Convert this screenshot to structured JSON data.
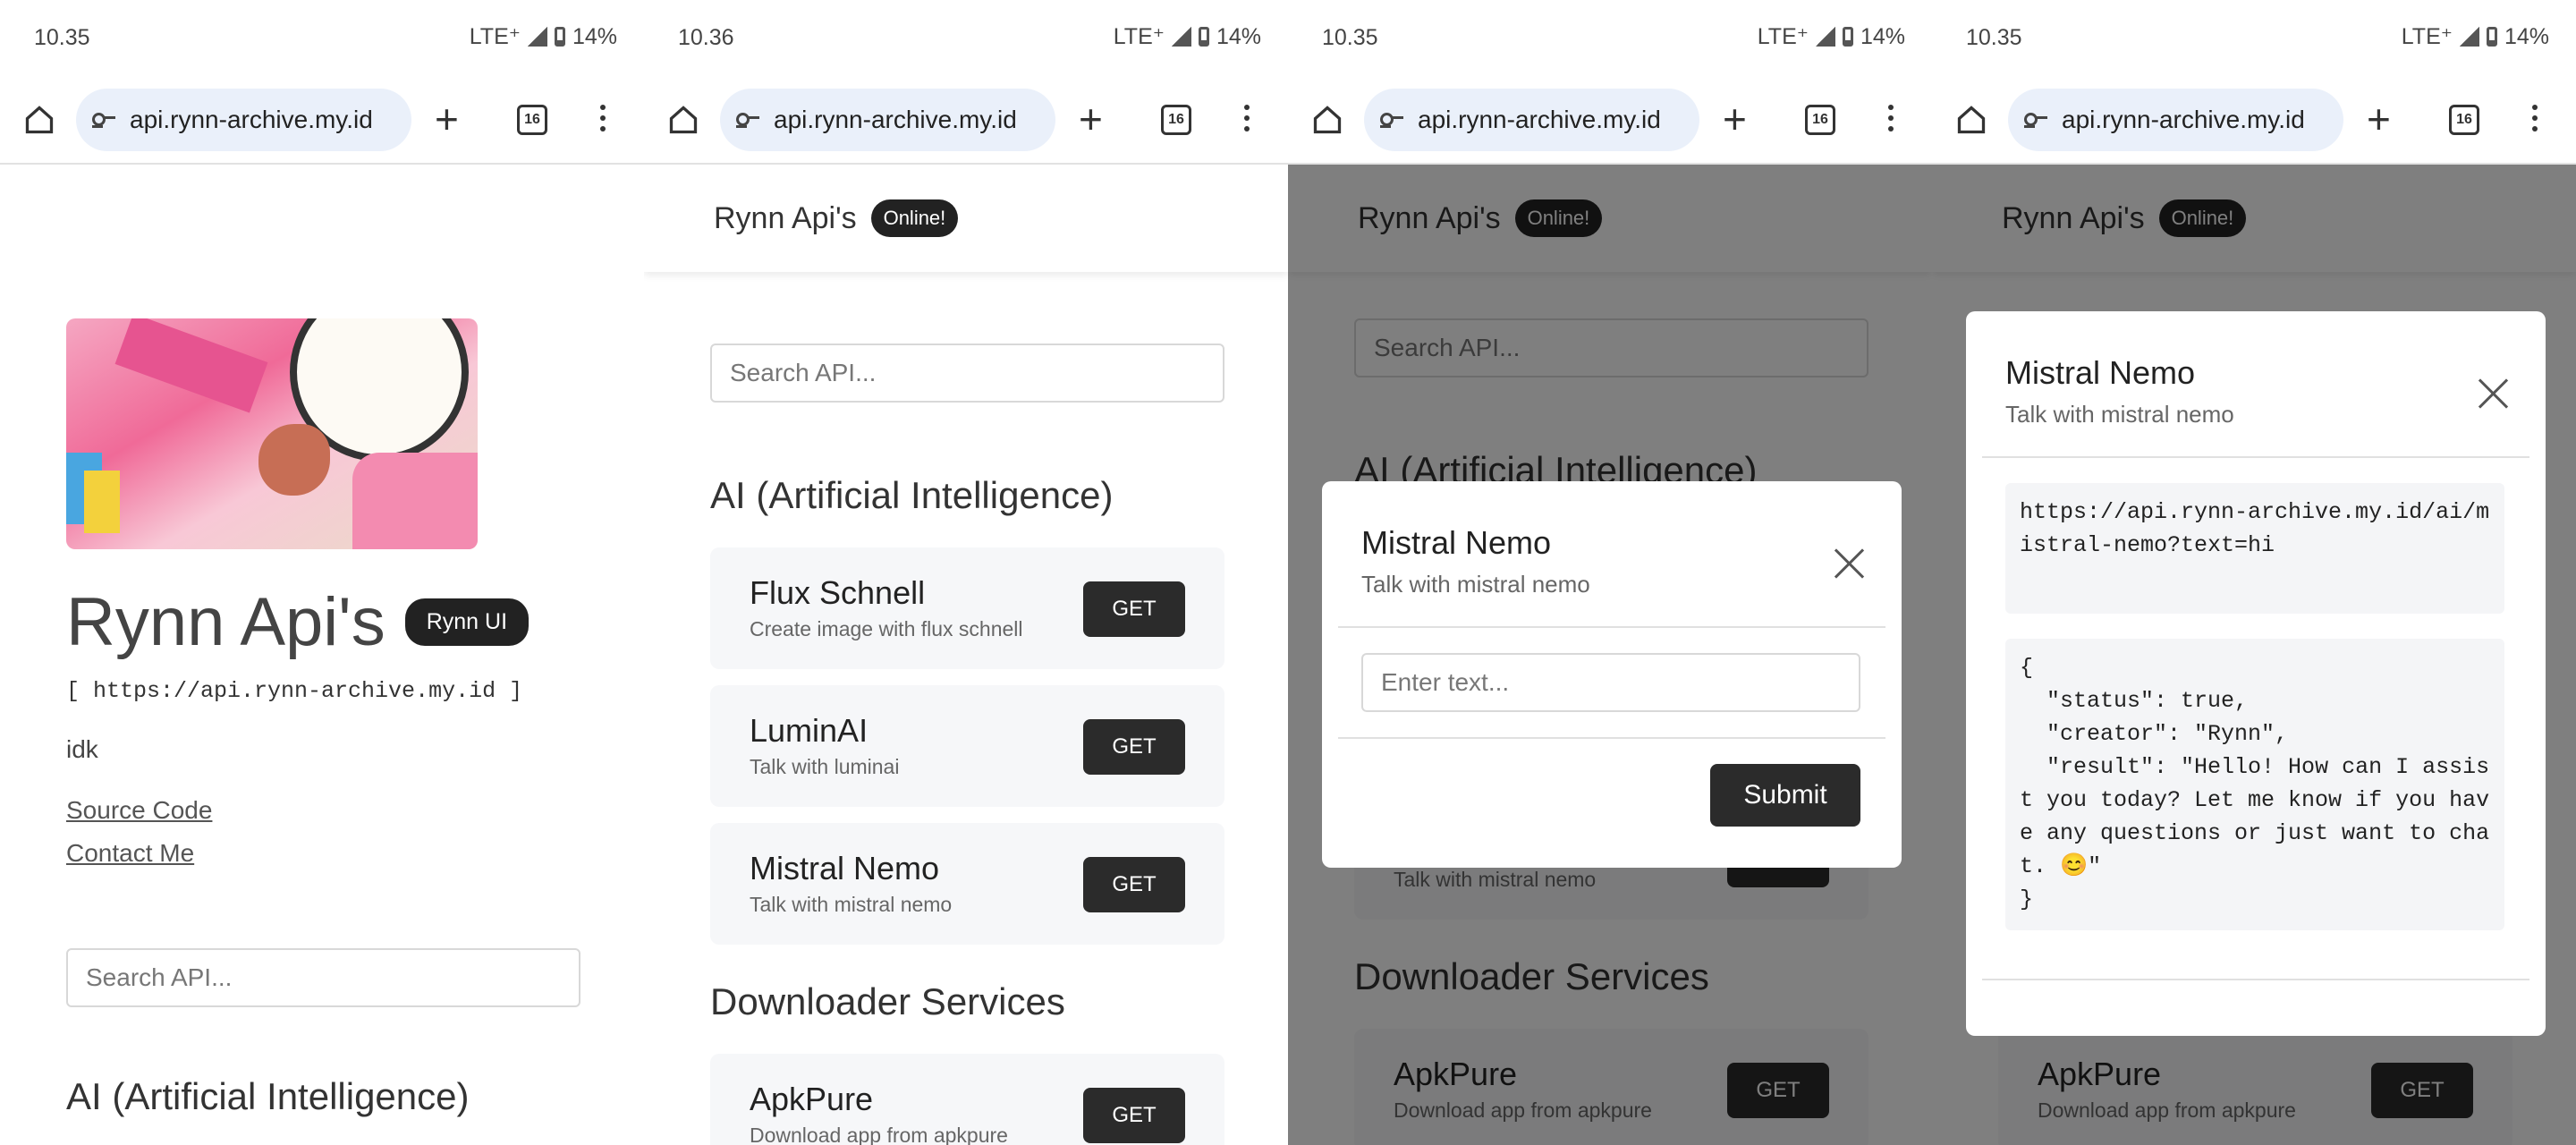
{
  "screens": [
    {
      "time": "10.35",
      "network": "LTE⁺",
      "battery": "14%",
      "url": "api.rynn-archive.my.id",
      "tab_count": "16"
    },
    {
      "time": "10.36",
      "network": "LTE⁺",
      "battery": "14%",
      "url": "api.rynn-archive.my.id",
      "tab_count": "16"
    },
    {
      "time": "10.35",
      "network": "LTE⁺",
      "battery": "14%",
      "url": "api.rynn-archive.my.id",
      "tab_count": "16"
    },
    {
      "time": "10.35",
      "network": "LTE⁺",
      "battery": "14%",
      "url": "api.rynn-archive.my.id",
      "tab_count": "16"
    }
  ],
  "site": {
    "title": "Rynn Api's",
    "online_badge": "Online!",
    "ui_badge": "Rynn UI",
    "base_url": "[ https://api.rynn-archive.my.id ]",
    "tagline": "idk",
    "source_code": "Source Code",
    "contact_me": "Contact Me",
    "search_placeholder": "Search API...",
    "get_label": "GET"
  },
  "sections": {
    "ai": "AI (Artificial Intelligence)",
    "downloader": "Downloader Services"
  },
  "apis": [
    {
      "name": "Flux Schnell",
      "desc": "Create image with flux schnell"
    },
    {
      "name": "LuminAI",
      "desc": "Talk with luminai"
    },
    {
      "name": "Mistral Nemo",
      "desc": "Talk with mistral nemo"
    },
    {
      "name": "ApkPure",
      "desc": "Download app from apkpure"
    }
  ],
  "modal": {
    "title": "Mistral Nemo",
    "subtitle": "Talk with mistral nemo",
    "input_placeholder": "Enter text...",
    "submit_label": "Submit",
    "request_url": "https://api.rynn-archive.my.id/ai/mistral-nemo?text=hi",
    "response": "{\n  \"status\": true,\n  \"creator\": \"Rynn\",\n  \"result\": \"Hello! How can I assist you today? Let me know if you have any questions or just want to chat. 😊\"\n}"
  }
}
